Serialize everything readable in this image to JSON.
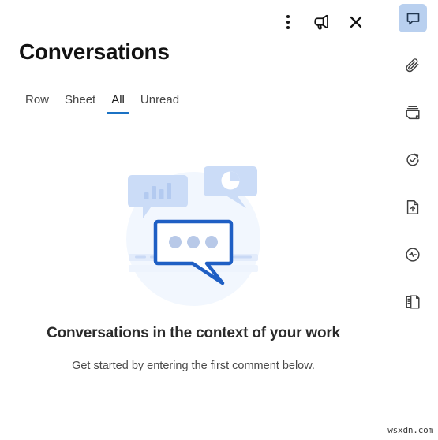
{
  "panel": {
    "title": "Conversations",
    "header_actions": [
      {
        "name": "more-options",
        "label": "More options",
        "icon": "more-vertical-icon"
      },
      {
        "name": "announcements",
        "label": "Announcements",
        "icon": "megaphone-icon"
      },
      {
        "name": "close",
        "label": "Close",
        "icon": "close-icon"
      }
    ],
    "tabs": [
      {
        "label": "Row",
        "active": false
      },
      {
        "label": "Sheet",
        "active": false
      },
      {
        "label": "All",
        "active": true
      },
      {
        "label": "Unread",
        "active": false
      }
    ],
    "empty_state": {
      "title": "Conversations in the context of your work",
      "subtitle": "Get started by entering the first comment below.",
      "illustration": "conversation-bubbles-illustration"
    }
  },
  "rail": {
    "items": [
      {
        "name": "conversations",
        "icon": "speech-bubble-icon",
        "active": true
      },
      {
        "name": "attachments",
        "icon": "paperclip-icon",
        "active": false
      },
      {
        "name": "proofs",
        "icon": "card-stack-icon",
        "active": false
      },
      {
        "name": "update-requests",
        "icon": "refresh-check-icon",
        "active": false
      },
      {
        "name": "publish",
        "icon": "file-upload-icon",
        "active": false
      },
      {
        "name": "activity-log",
        "icon": "activity-pulse-icon",
        "active": false
      },
      {
        "name": "summary",
        "icon": "document-list-icon",
        "active": false
      }
    ]
  },
  "watermark": {
    "text": "wsxdn.com"
  },
  "colors": {
    "accent_blue": "#1b72c4",
    "illustration_stroke": "#1f5fc4",
    "illustration_light": "#c9d9f5",
    "rail_active_bg": "#b9d0ef",
    "text_primary": "#121212"
  }
}
